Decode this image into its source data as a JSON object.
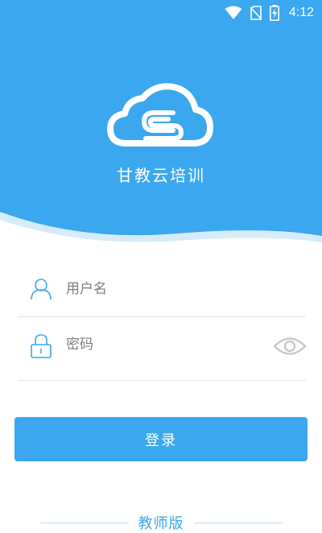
{
  "status_bar": {
    "time": "4:12"
  },
  "header": {
    "app_title": "甘教云培训",
    "brand_color": "#3aa7ee"
  },
  "login_form": {
    "username_placeholder": "用户名",
    "password_placeholder": "密码",
    "login_button": "登录"
  },
  "footer": {
    "edition_label": "教师版"
  },
  "icons": [
    "wifi-icon",
    "no-sim-icon",
    "battery-charging-icon",
    "cloud-logo-icon",
    "user-icon",
    "lock-icon",
    "eye-icon"
  ]
}
